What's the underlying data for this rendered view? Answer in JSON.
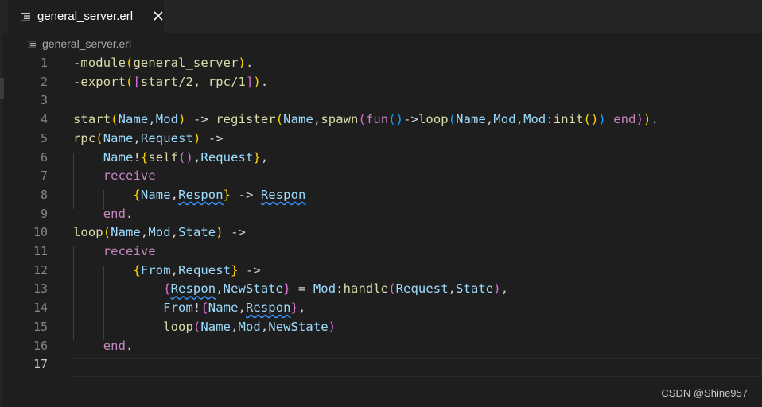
{
  "tab": {
    "label": "general_server.erl"
  },
  "breadcrumb": {
    "label": "general_server.erl"
  },
  "editor": {
    "line_numbers": [
      "1",
      "2",
      "3",
      "4",
      "5",
      "6",
      "7",
      "8",
      "9",
      "10",
      "11",
      "12",
      "13",
      "14",
      "15",
      "16",
      "17"
    ],
    "active_line": "17",
    "lines": [
      [
        [
          "-module",
          "fn"
        ],
        [
          "(",
          "b1"
        ],
        [
          "general_server",
          "fn"
        ],
        [
          ")",
          "b1"
        ],
        [
          ".",
          "pu"
        ]
      ],
      [
        [
          "-export",
          "fn"
        ],
        [
          "(",
          "b1"
        ],
        [
          "[",
          "b2"
        ],
        [
          "start/2, rpc/1",
          "fn"
        ],
        [
          "]",
          "b2"
        ],
        [
          ")",
          "b1"
        ],
        [
          ".",
          "pu"
        ]
      ],
      [],
      [
        [
          "start",
          "fn"
        ],
        [
          "(",
          "b1"
        ],
        [
          "Name",
          "vr"
        ],
        [
          ",",
          "pu"
        ],
        [
          "Mod",
          "vr"
        ],
        [
          ")",
          "b1"
        ],
        [
          " -> ",
          "pu"
        ],
        [
          "register",
          "fn"
        ],
        [
          "(",
          "b1"
        ],
        [
          "Name",
          "vr"
        ],
        [
          ",",
          "pu"
        ],
        [
          "spawn",
          "fn"
        ],
        [
          "(",
          "b2"
        ],
        [
          "fun",
          "kw"
        ],
        [
          "()",
          "b3"
        ],
        [
          "->",
          "pu"
        ],
        [
          "loop",
          "fn"
        ],
        [
          "(",
          "b3"
        ],
        [
          "Name",
          "vr"
        ],
        [
          ",",
          "pu"
        ],
        [
          "Mod",
          "vr"
        ],
        [
          ",",
          "pu"
        ],
        [
          "Mod",
          "vr"
        ],
        [
          ":",
          "pu"
        ],
        [
          "init",
          "fn"
        ],
        [
          "()",
          "b1"
        ],
        [
          ")",
          "b3"
        ],
        [
          " end",
          "kw"
        ],
        [
          ")",
          "b2"
        ],
        [
          ")",
          "b1"
        ],
        [
          ".",
          "pu"
        ]
      ],
      [
        [
          "rpc",
          "fn"
        ],
        [
          "(",
          "b1"
        ],
        [
          "Name",
          "vr"
        ],
        [
          ",",
          "pu"
        ],
        [
          "Request",
          "vr"
        ],
        [
          ")",
          "b1"
        ],
        [
          " ->",
          "pu"
        ]
      ],
      [
        [
          "    Name",
          "vr"
        ],
        [
          "!",
          "pu"
        ],
        [
          "{",
          "b1"
        ],
        [
          "self",
          "fn"
        ],
        [
          "()",
          "b2"
        ],
        [
          ",",
          "pu"
        ],
        [
          "Request",
          "vr"
        ],
        [
          "}",
          "b1"
        ],
        [
          ",",
          "pu"
        ]
      ],
      [
        [
          "    receive",
          "kw"
        ]
      ],
      [
        [
          "        ",
          "pu"
        ],
        [
          "{",
          "b1"
        ],
        [
          "Name",
          "vr"
        ],
        [
          ",",
          "pu"
        ],
        [
          "Respon",
          "vr sq"
        ],
        [
          "}",
          "b1"
        ],
        [
          " -> ",
          "pu"
        ],
        [
          "Respon",
          "vr sq"
        ]
      ],
      [
        [
          "    end",
          "kw"
        ],
        [
          ".",
          "pu"
        ]
      ],
      [
        [
          "loop",
          "fn"
        ],
        [
          "(",
          "b1"
        ],
        [
          "Name",
          "vr"
        ],
        [
          ",",
          "pu"
        ],
        [
          "Mod",
          "vr"
        ],
        [
          ",",
          "pu"
        ],
        [
          "State",
          "vr"
        ],
        [
          ")",
          "b1"
        ],
        [
          " ->",
          "pu"
        ]
      ],
      [
        [
          "    receive",
          "kw"
        ]
      ],
      [
        [
          "        ",
          "pu"
        ],
        [
          "{",
          "b1"
        ],
        [
          "From",
          "vr"
        ],
        [
          ",",
          "pu"
        ],
        [
          "Request",
          "vr"
        ],
        [
          "}",
          "b1"
        ],
        [
          " ->",
          "pu"
        ]
      ],
      [
        [
          "            ",
          "pu"
        ],
        [
          "{",
          "b2"
        ],
        [
          "Respon",
          "vr sq"
        ],
        [
          ",",
          "pu"
        ],
        [
          "NewState",
          "vr"
        ],
        [
          "}",
          "b2"
        ],
        [
          " = ",
          "pu"
        ],
        [
          "Mod",
          "vr"
        ],
        [
          ":",
          "pu"
        ],
        [
          "handle",
          "fn"
        ],
        [
          "(",
          "b2"
        ],
        [
          "Request",
          "vr"
        ],
        [
          ",",
          "pu"
        ],
        [
          "State",
          "vr"
        ],
        [
          ")",
          "b2"
        ],
        [
          ",",
          "pu"
        ]
      ],
      [
        [
          "            From",
          "vr"
        ],
        [
          "!",
          "pu"
        ],
        [
          "{",
          "b2"
        ],
        [
          "Name",
          "vr"
        ],
        [
          ",",
          "pu"
        ],
        [
          "Respon",
          "vr sq"
        ],
        [
          "}",
          "b2"
        ],
        [
          ",",
          "pu"
        ]
      ],
      [
        [
          "            loop",
          "fn"
        ],
        [
          "(",
          "b2"
        ],
        [
          "Name",
          "vr"
        ],
        [
          ",",
          "pu"
        ],
        [
          "Mod",
          "vr"
        ],
        [
          ",",
          "pu"
        ],
        [
          "NewState",
          "vr"
        ],
        [
          ")",
          "b2"
        ]
      ],
      [
        [
          "    end",
          "kw"
        ],
        [
          ".",
          "pu"
        ]
      ],
      []
    ]
  },
  "watermark": "CSDN @Shine957"
}
